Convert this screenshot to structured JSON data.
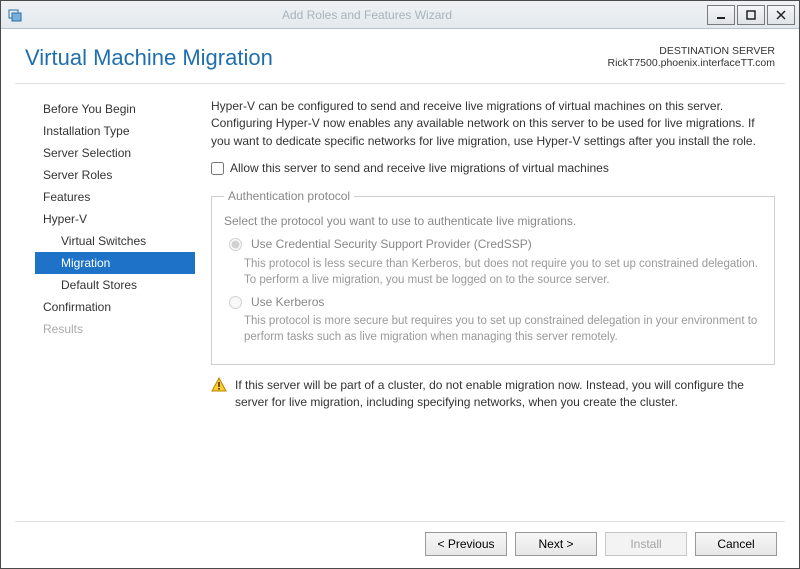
{
  "window": {
    "title": "Add Roles and Features Wizard"
  },
  "header": {
    "page_title": "Virtual Machine Migration",
    "destination_label": "DESTINATION SERVER",
    "destination_value": "RickT7500.phoenix.interfaceTT.com"
  },
  "sidebar": {
    "items": [
      {
        "label": "Before You Begin"
      },
      {
        "label": "Installation Type"
      },
      {
        "label": "Server Selection"
      },
      {
        "label": "Server Roles"
      },
      {
        "label": "Features"
      },
      {
        "label": "Hyper-V"
      },
      {
        "label": "Virtual Switches",
        "sub": true
      },
      {
        "label": "Migration",
        "sub": true,
        "selected": true
      },
      {
        "label": "Default Stores",
        "sub": true
      },
      {
        "label": "Confirmation"
      },
      {
        "label": "Results",
        "disabled": true
      }
    ]
  },
  "main": {
    "intro": "Hyper-V can be configured to send and receive live migrations of virtual machines on this server. Configuring Hyper-V now enables any available network on this server to be used for live migrations. If you want to dedicate specific networks for live migration, use Hyper-V settings after you install the role.",
    "allow_checkbox_label": "Allow this server to send and receive live migrations of virtual machines",
    "auth": {
      "legend": "Authentication protocol",
      "subtext": "Select the protocol you want to use to authenticate live migrations.",
      "credssp_label": "Use Credential Security Support Provider (CredSSP)",
      "credssp_desc": "This protocol is less secure than Kerberos, but does not require you to set up constrained delegation. To perform a live migration, you must be logged on to the source server.",
      "kerberos_label": "Use Kerberos",
      "kerberos_desc": "This protocol is more secure but requires you to set up constrained delegation in your environment to perform tasks such as live migration when managing this server remotely."
    },
    "warning": "If this server will be part of a cluster, do not enable migration now. Instead, you will configure the server for live migration, including specifying networks, when you create the cluster."
  },
  "footer": {
    "previous": "< Previous",
    "next": "Next >",
    "install": "Install",
    "cancel": "Cancel"
  }
}
